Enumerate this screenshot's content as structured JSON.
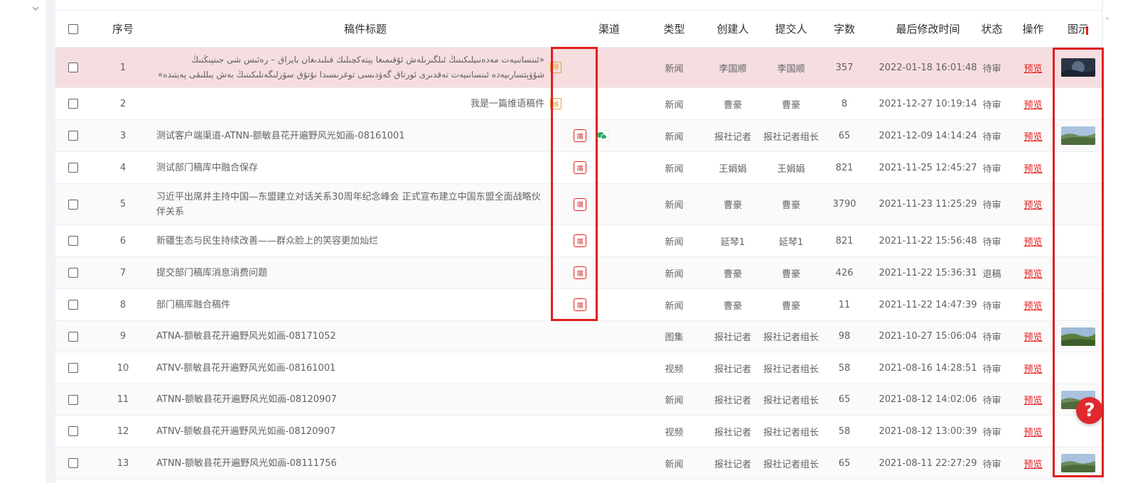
{
  "columns": {
    "seq": "序号",
    "title": "稿件标题",
    "channel": "渠道",
    "type": "类型",
    "creator": "创建人",
    "submitter": "提交人",
    "words": "字数",
    "modified": "最后修改时间",
    "status": "状态",
    "op": "操作",
    "image": "图示"
  },
  "rows": [
    {
      "seq": "1",
      "title_lines": [
        "«ئىنسانىيەت مەدەنىيلىكىنىڭ ئىلگىرىلەش ئۇقىمىغا يېتەكچىلىك قىلىدىغان بايراق – رەئىس شى جىنپىڭنىڭ",
        "شۇۋېتسارىيەدە ئىنسانىيەت تەقدىرى ئورتاق گەۋدىسى توغرىسىدا نۇتۇق سۆزلىگەنلىكىنىڭ بەش يىللىقى پەيتىدە»"
      ],
      "lang_tag": "维",
      "duan": false,
      "wechat": false,
      "type": "新闻",
      "creator": "李国顺",
      "submitter": "李国顺",
      "words": "357",
      "modified": "2022-01-18 16:01:48",
      "status": "待审",
      "op": "预览",
      "image": "photo-dark"
    },
    {
      "seq": "2",
      "title": "我是一篇维语稿件",
      "lang_tag": "维",
      "duan": false,
      "wechat": false,
      "type": "新闻",
      "creator": "曹豪",
      "submitter": "曹豪",
      "words": "8",
      "modified": "2021-12-27 10:19:14",
      "status": "待审",
      "op": "预览",
      "image": ""
    },
    {
      "seq": "3",
      "title": "测试客户端渠道-ATNN-额敏县花开遍野风光如画-08161001",
      "duan": true,
      "wechat": true,
      "type": "新闻",
      "creator": "报社记者",
      "submitter": "报社记者组长",
      "words": "65",
      "modified": "2021-12-09 14:14:24",
      "status": "待审",
      "op": "预览",
      "image": "photo-landscape"
    },
    {
      "seq": "4",
      "title": "测试部门稿库中融合保存",
      "duan": true,
      "wechat": false,
      "type": "新闻",
      "creator": "王娟娟",
      "submitter": "王娟娟",
      "words": "821",
      "modified": "2021-11-25 12:45:27",
      "status": "待审",
      "op": "预览",
      "image": ""
    },
    {
      "seq": "5",
      "title_lines": [
        "习近平出席并主持中国—东盟建立对话关系30周年纪念峰会 正式宣布建立中国东盟全面战略伙",
        "伴关系"
      ],
      "duan": true,
      "wechat": false,
      "type": "新闻",
      "creator": "曹豪",
      "submitter": "曹豪",
      "words": "3790",
      "modified": "2021-11-23 11:25:29",
      "status": "待审",
      "op": "预览",
      "image": ""
    },
    {
      "seq": "6",
      "title": "新疆生态与民生持续改善——群众脸上的笑容更加灿烂",
      "duan": true,
      "wechat": false,
      "type": "新闻",
      "creator": "延琴1",
      "submitter": "延琴1",
      "words": "821",
      "modified": "2021-11-22 15:56:48",
      "status": "待审",
      "op": "预览",
      "image": ""
    },
    {
      "seq": "7",
      "title": "提交部门稿库消息消费问题",
      "duan": true,
      "wechat": false,
      "type": "新闻",
      "creator": "曹豪",
      "submitter": "曹豪",
      "words": "426",
      "modified": "2021-11-22 15:36:31",
      "status": "退稿",
      "op": "预览",
      "image": ""
    },
    {
      "seq": "8",
      "title": "部门稿库融合稿件",
      "duan": true,
      "wechat": false,
      "type": "新闻",
      "creator": "曹豪",
      "submitter": "曹豪",
      "words": "11",
      "modified": "2021-11-22 14:47:39",
      "status": "待审",
      "op": "预览",
      "image": ""
    },
    {
      "seq": "9",
      "title": "ATNA-额敏县花开遍野风光如画-08171052",
      "duan": false,
      "wechat": false,
      "type": "图集",
      "creator": "报社记者",
      "submitter": "报社记者组长",
      "words": "98",
      "modified": "2021-10-27 15:06:04",
      "status": "待审",
      "op": "预览",
      "image": "photo-green"
    },
    {
      "seq": "10",
      "title": "ATNV-额敏县花开遍野风光如画-08161001",
      "duan": false,
      "wechat": false,
      "type": "视频",
      "creator": "报社记者",
      "submitter": "报社记者组长",
      "words": "58",
      "modified": "2021-08-16 14:28:51",
      "status": "待审",
      "op": "预览",
      "image": ""
    },
    {
      "seq": "11",
      "title": "ATNN-额敏县花开遍野风光如画-08120907",
      "duan": false,
      "wechat": false,
      "type": "新闻",
      "creator": "报社记者",
      "submitter": "报社记者组长",
      "words": "65",
      "modified": "2021-08-12 14:02:06",
      "status": "待审",
      "op": "预览",
      "image": "photo-landscape"
    },
    {
      "seq": "12",
      "title": "ATNV-额敏县花开遍野风光如画-08120907",
      "duan": false,
      "wechat": false,
      "type": "视频",
      "creator": "报社记者",
      "submitter": "报社记者组长",
      "words": "58",
      "modified": "2021-08-12 13:00:39",
      "status": "待审",
      "op": "预览",
      "image": ""
    },
    {
      "seq": "13",
      "title": "ATNN-额敏县花开遍野风光如画-08111756",
      "duan": false,
      "wechat": false,
      "type": "新闻",
      "creator": "报社记者",
      "submitter": "报社记者组长",
      "words": "65",
      "modified": "2021-08-11 22:27:29",
      "status": "待审",
      "op": "预览",
      "image": "photo-landscape"
    }
  ],
  "duan_label": "端",
  "help_label": "?",
  "icons": {
    "collapse": "chevron-down-icon",
    "wechat": "wechat-icon",
    "help": "help-icon"
  },
  "colors": {
    "highlight_row": "#f6dde0",
    "annotation": "#e02020",
    "preview_link": "#e02020",
    "lang_tag": "#e6a23c",
    "help_button": "#e0282e"
  }
}
